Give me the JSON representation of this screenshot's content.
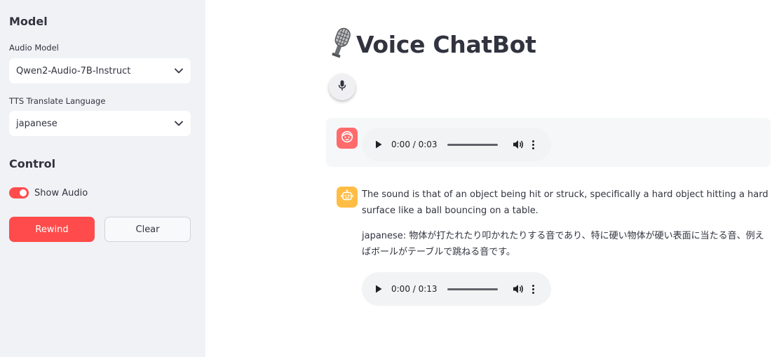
{
  "sidebar": {
    "model_heading": "Model",
    "audio_model_label": "Audio Model",
    "audio_model_value": "Qwen2-Audio-7B-Instruct",
    "tts_label": "TTS Translate Language",
    "tts_value": "japanese",
    "control_heading": "Control",
    "show_audio_label": "Show Audio",
    "show_audio_on": true,
    "rewind_label": "Rewind",
    "clear_label": "Clear"
  },
  "main": {
    "title_icon": "microphone-emoji",
    "title": "Voice ChatBot",
    "record_icon": "mic-icon"
  },
  "messages": [
    {
      "role": "user",
      "avatar_icon": "user-face-icon",
      "audio": {
        "time": "0:00 / 0:03"
      }
    },
    {
      "role": "assistant",
      "avatar_icon": "robot-icon",
      "text": "The sound is that of an object being hit or struck, specifically a hard object hitting a hard surface like a ball bouncing on a table.",
      "translation": "japanese: 物体が打たれたり叩かれたりする音であり、特に硬い物体が硬い表面に当たる音、例えばボールがテーブルで跳ねる音です。",
      "audio": {
        "time": "0:00 / 0:13"
      }
    }
  ],
  "colors": {
    "accent": "#ff4b4b",
    "sidebar_bg": "#f0f2f6",
    "user_avatar": "#ff6b6b",
    "bot_avatar": "#ffbd45"
  }
}
